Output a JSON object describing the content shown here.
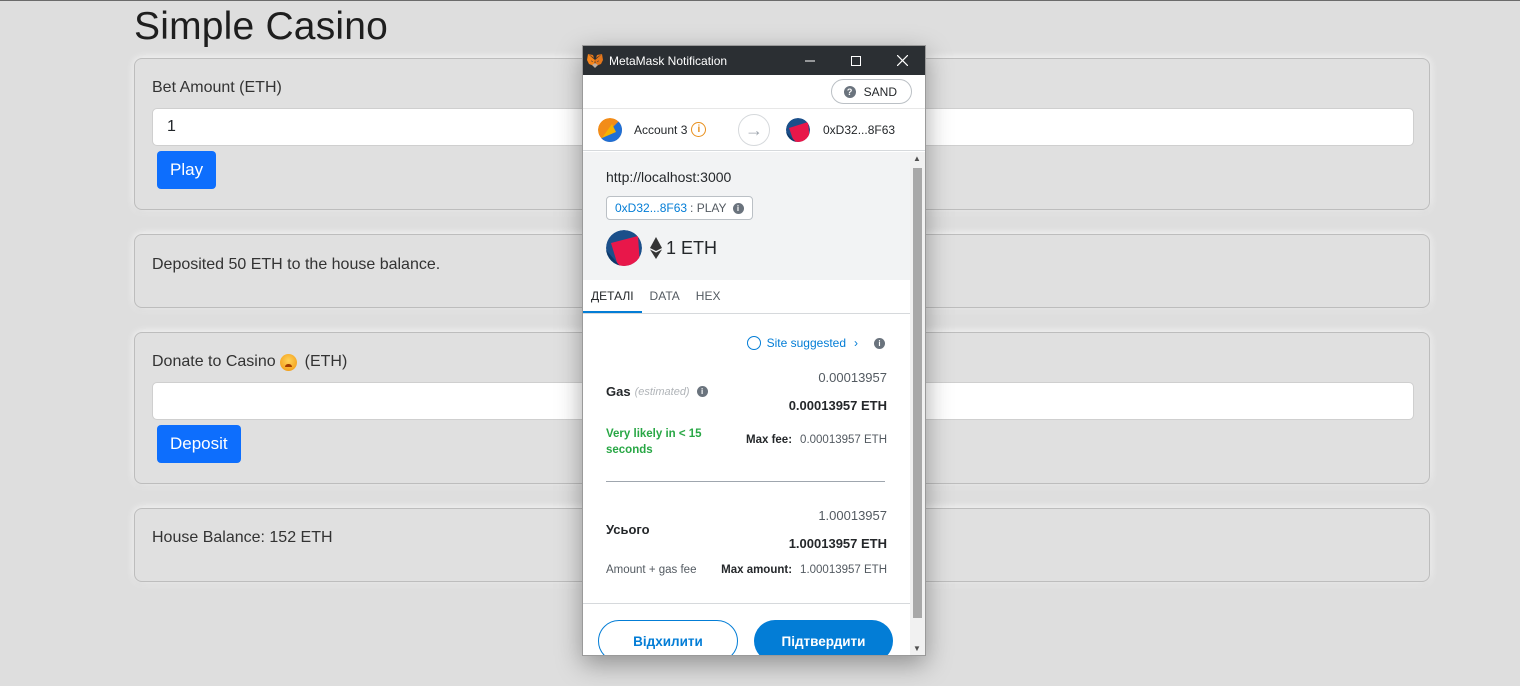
{
  "page": {
    "title": "Simple Casino",
    "bet": {
      "label": "Bet Amount (ETH)",
      "value": "1",
      "button": "Play"
    },
    "status": {
      "text": "Deposited 50 ETH to the house balance."
    },
    "donate": {
      "label_prefix": "Donate to Casino",
      "label_suffix": "(ETH)",
      "value": "",
      "button": "Deposit"
    },
    "house": {
      "text": "House Balance: 152 ETH"
    }
  },
  "metamask": {
    "window_title": "MetaMask Notification",
    "network": "SAND",
    "from_account": "Account 3",
    "to_address": "0xD32...8F63",
    "origin": "http://localhost:3000",
    "contract_address": "0xD32...8F63",
    "contract_method": ": PLAY",
    "amount": "1 ETH",
    "tabs": [
      "ДЕТАЛІ",
      "DATA",
      "HEX"
    ],
    "site_suggested": "Site suggested",
    "gas": {
      "label": "Gas",
      "estimated": "(estimated)",
      "value": "0.00013957",
      "value_eth": "0.00013957 ETH",
      "likely": "Very likely in < 15 seconds",
      "max_fee_label": "Max fee:",
      "max_fee_value": "0.00013957 ETH"
    },
    "total": {
      "label": "Усього",
      "value": "1.00013957",
      "value_eth": "1.00013957 ETH",
      "subtitle": "Amount + gas fee",
      "max_amount_label": "Max amount:",
      "max_amount_value": "1.00013957 ETH"
    },
    "buttons": {
      "reject": "Відхилити",
      "confirm": "Підтвердити"
    }
  }
}
